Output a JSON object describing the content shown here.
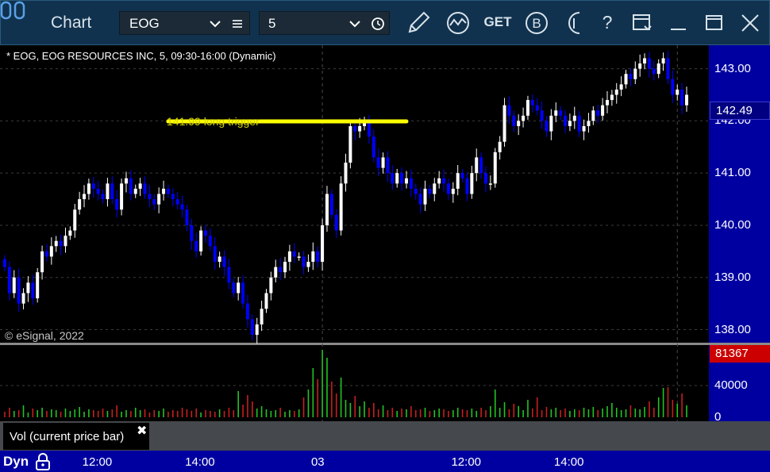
{
  "window": {
    "title": "Chart",
    "symbol": "EOG",
    "interval": "5",
    "toolbar_icons": [
      "chart-icon",
      "list-icon",
      "clock-icon",
      "pencil-icon",
      "analysis-icon",
      "get-icon",
      "b-icon",
      "info-icon",
      "help-icon",
      "template-icon",
      "minimize-icon",
      "maximize-icon",
      "close-icon"
    ],
    "get_label": "GET",
    "b_label": "B",
    "help_label": "?"
  },
  "chart": {
    "header": "* EOG, EOG RESOURCES INC, 5, 09:30-16:00 (Dynamic)",
    "copyright": "© eSignal, 2022",
    "annotation": "141.99 long trigger",
    "last_price": "142.49",
    "vol_last": "81367",
    "vol_legend": "Vol (current price bar)",
    "vol_close": "✖",
    "mode": "Dyn",
    "colors": {
      "up": "#ffffff",
      "down": "#0000ff",
      "trigger": "#ffff00",
      "vol_up": "#22c422",
      "vol_down": "#c81e1e",
      "axis_bg": "#0000a0"
    }
  },
  "chart_data": {
    "type": "candlestick",
    "price_ticks": [
      "143.00",
      "142.00",
      "141.00",
      "140.00",
      "139.00",
      "138.00"
    ],
    "price_tick_values": [
      143,
      142,
      141,
      140,
      139,
      138
    ],
    "ylim": [
      137.75,
      143.45
    ],
    "volume_ticks": [
      "40000",
      "0"
    ],
    "volume_tick_values": [
      40000,
      0
    ],
    "volume_ylim": [
      0,
      85000
    ],
    "time_labels": [
      "12:00",
      "14:00",
      "03",
      "12:00",
      "14:00"
    ],
    "time_label_bars": [
      20,
      42,
      69,
      99,
      121
    ],
    "session_break_bars": [
      68,
      144
    ],
    "trigger": {
      "price": 141.99,
      "from_bar": 35,
      "to_bar": 86
    },
    "closes": [
      139.2,
      138.7,
      139.0,
      138.5,
      138.7,
      138.9,
      138.6,
      139.1,
      139.5,
      139.4,
      139.6,
      139.7,
      139.6,
      139.8,
      139.9,
      140.3,
      140.5,
      140.6,
      140.8,
      140.7,
      140.6,
      140.5,
      140.8,
      140.5,
      140.3,
      140.8,
      140.9,
      140.6,
      140.7,
      140.8,
      140.6,
      140.5,
      140.4,
      140.6,
      140.7,
      140.6,
      140.5,
      140.4,
      140.3,
      140.0,
      139.7,
      139.5,
      139.9,
      139.8,
      139.6,
      139.3,
      139.4,
      139.2,
      138.9,
      138.7,
      138.9,
      138.5,
      138.2,
      137.9,
      138.1,
      138.4,
      138.7,
      139.0,
      139.2,
      139.1,
      139.3,
      139.5,
      139.4,
      139.4,
      139.2,
      139.3,
      139.5,
      139.3,
      140.0,
      140.6,
      140.2,
      139.9,
      140.8,
      141.2,
      141.9,
      141.8,
      141.9,
      142.0,
      141.7,
      141.3,
      141.1,
      141.3,
      141.0,
      140.8,
      141.0,
      140.8,
      140.9,
      140.7,
      140.6,
      140.4,
      140.7,
      140.6,
      140.8,
      140.9,
      140.8,
      140.6,
      140.7,
      141.0,
      140.9,
      140.6,
      141.0,
      141.3,
      141.0,
      140.8,
      140.8,
      141.4,
      141.6,
      142.3,
      142.1,
      141.9,
      142.0,
      142.1,
      142.4,
      142.3,
      142.2,
      142.0,
      141.8,
      142.1,
      142.2,
      142.1,
      141.9,
      142.0,
      142.1,
      141.8,
      141.9,
      142.0,
      142.2,
      142.1,
      142.3,
      142.4,
      142.5,
      142.6,
      142.7,
      142.9,
      142.8,
      143.0,
      143.1,
      143.2,
      143.0,
      142.9,
      143.1,
      143.2,
      142.8,
      142.5,
      142.6,
      142.3,
      142.5
    ],
    "volumes": [
      7000,
      12000,
      8000,
      9000,
      15000,
      6000,
      11000,
      9000,
      12000,
      8000,
      10000,
      9000,
      7000,
      11000,
      8000,
      10000,
      13000,
      7000,
      10000,
      9000,
      8000,
      11000,
      8000,
      10000,
      15000,
      7000,
      9000,
      8000,
      12000,
      9000,
      10000,
      6000,
      9000,
      8000,
      11000,
      7000,
      9000,
      8000,
      12000,
      10000,
      8000,
      11000,
      6000,
      9000,
      8000,
      7000,
      10000,
      8000,
      12000,
      9000,
      33000,
      16000,
      28000,
      20000,
      11000,
      14000,
      10000,
      8000,
      9000,
      12000,
      7000,
      9000,
      8000,
      10000,
      25000,
      35000,
      62000,
      48000,
      85000,
      75000,
      45000,
      30000,
      50000,
      22000,
      18000,
      27000,
      14000,
      20000,
      12000,
      18000,
      10000,
      15000,
      9000,
      12000,
      8000,
      11000,
      10000,
      14000,
      9000,
      10000,
      12000,
      8000,
      9000,
      11000,
      10000,
      8000,
      9000,
      12000,
      10000,
      9000,
      11000,
      8000,
      12000,
      9000,
      14000,
      35000,
      12000,
      19000,
      10000,
      17000,
      14000,
      9000,
      22000,
      11000,
      25000,
      9000,
      13000,
      10000,
      12000,
      9000,
      11000,
      8000,
      10000,
      9000,
      12000,
      10000,
      13000,
      9000,
      11000,
      14000,
      18000,
      12000,
      9000,
      10000,
      15000,
      11000,
      10000,
      13000,
      20000,
      12000,
      25000,
      37000,
      38000,
      22000,
      17000,
      30000,
      15000,
      20000,
      50000,
      81367
    ]
  }
}
